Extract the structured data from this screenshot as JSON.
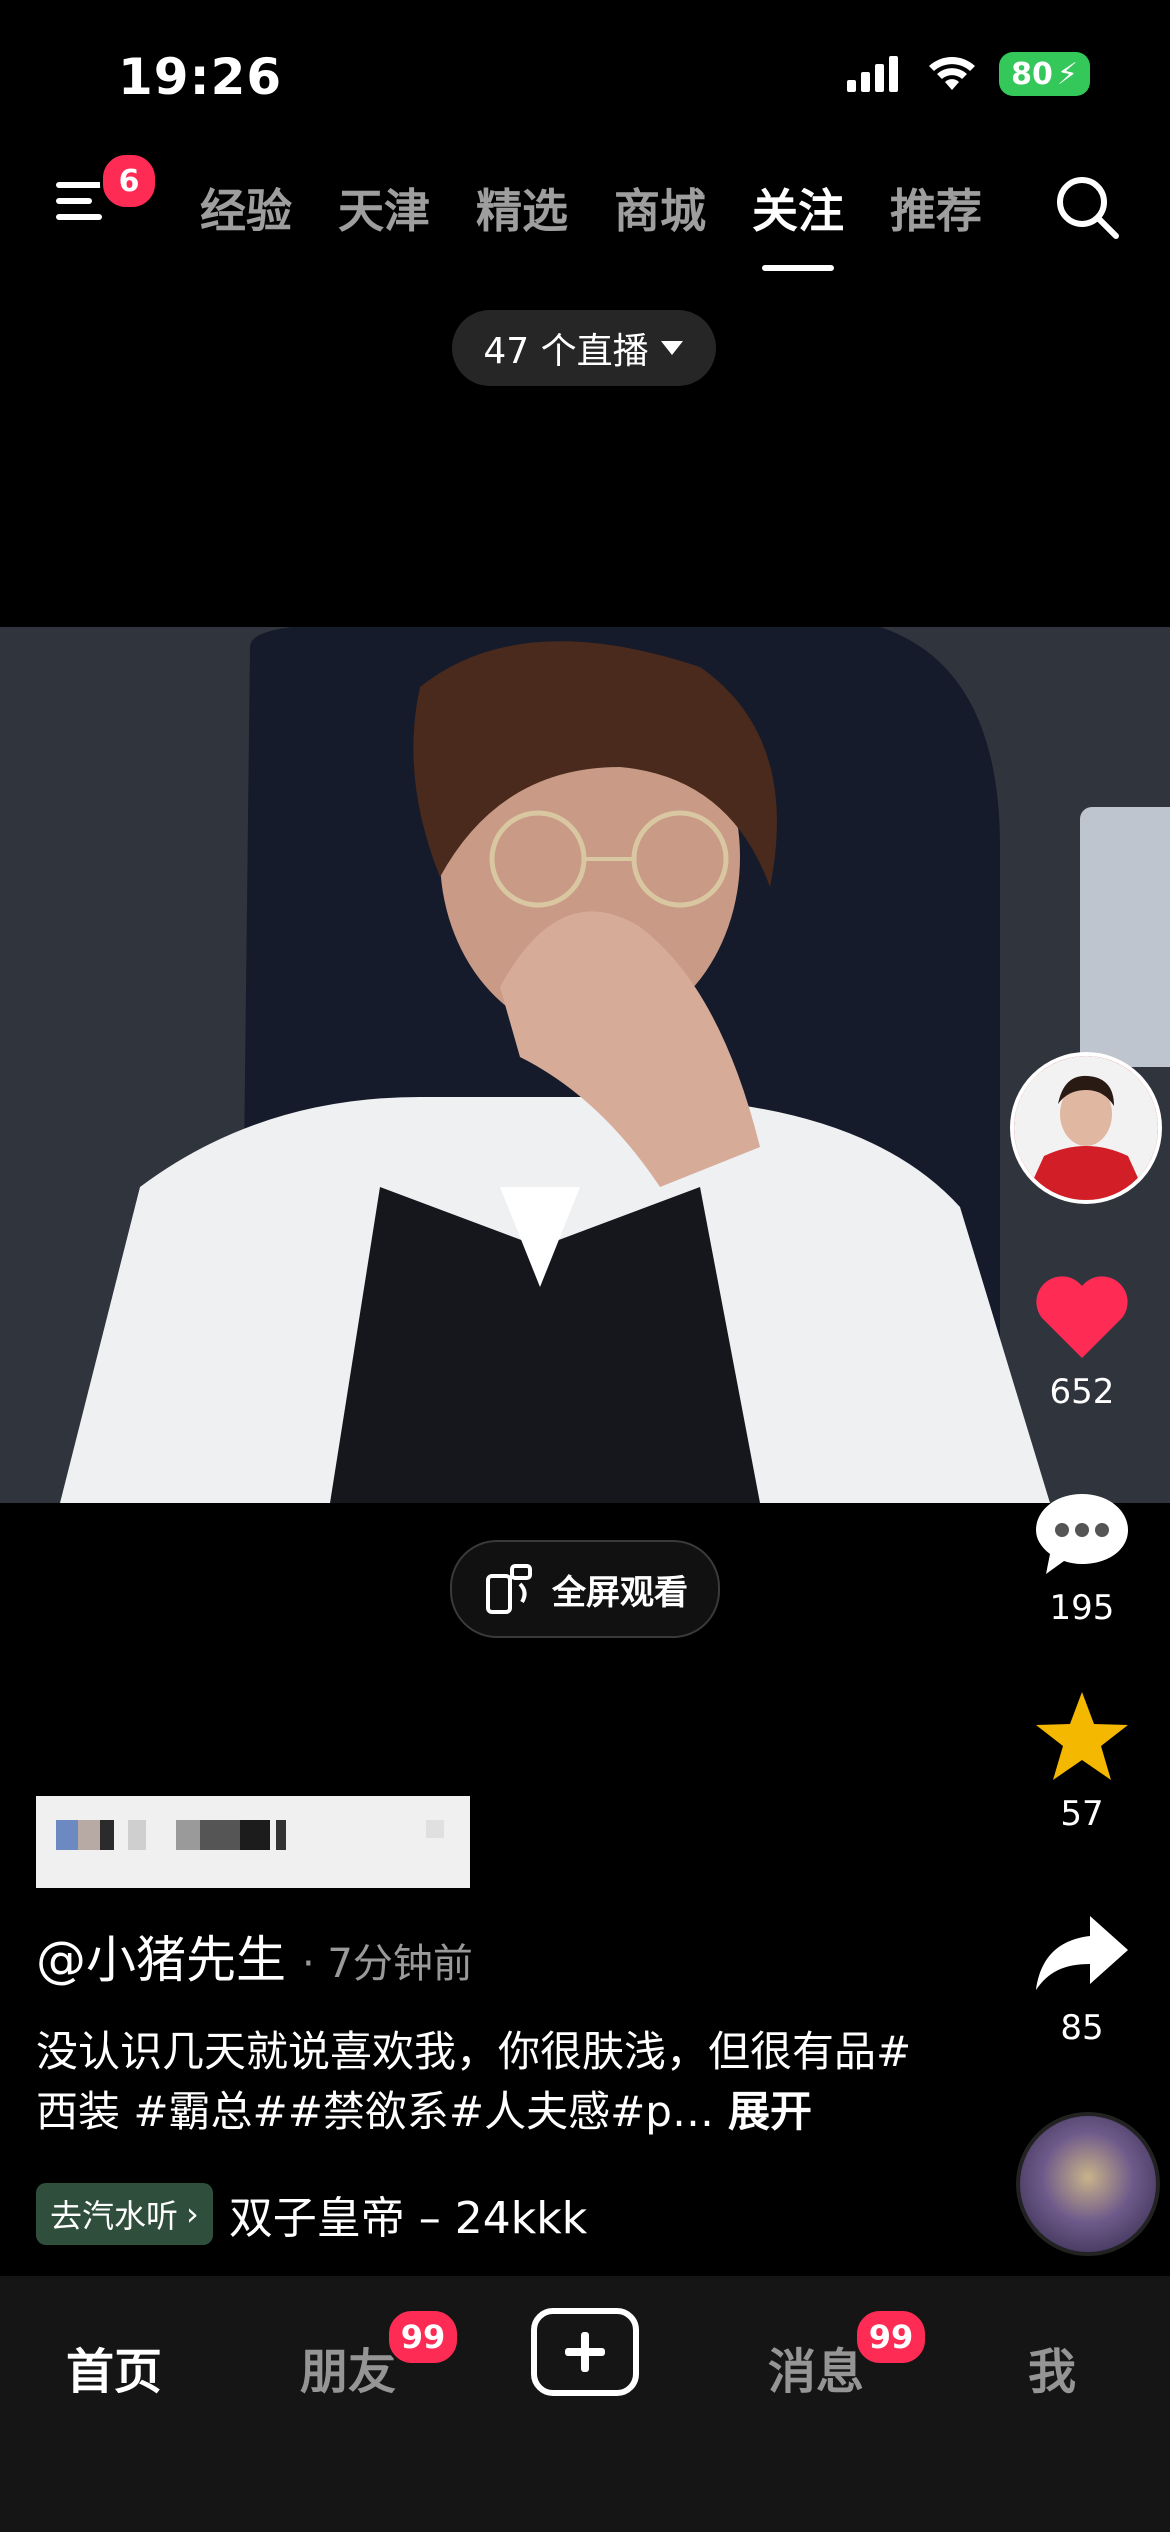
{
  "status": {
    "time": "19:26",
    "battery": "80"
  },
  "topnav": {
    "menu_badge": "6",
    "tabs": [
      "经验",
      "天津",
      "精选",
      "商城",
      "关注",
      "推荐"
    ],
    "active_tab": "关注"
  },
  "live": {
    "label": "47 个直播"
  },
  "video": {
    "fullscreen_label": "全屏观看"
  },
  "actions": {
    "likes": "652",
    "comments": "195",
    "favorites": "57",
    "shares": "85"
  },
  "post": {
    "author": "@小猪先生",
    "time": "· 7分钟前",
    "description": "没认识几天就说喜欢我，你很肤浅，但很有品#西装 #霸总##禁欲系#人夫感#p…",
    "expand": "展开",
    "music_tag": "去汽水听",
    "music_title": "双子皇帝 – 24kkk"
  },
  "bottomnav": {
    "home": "首页",
    "friends": "朋友",
    "friends_badge": "99",
    "messages": "消息",
    "messages_badge": "99",
    "me": "我"
  },
  "colors": {
    "accent": "#fe2c55",
    "star": "#f5b800",
    "battery": "#34c759"
  }
}
